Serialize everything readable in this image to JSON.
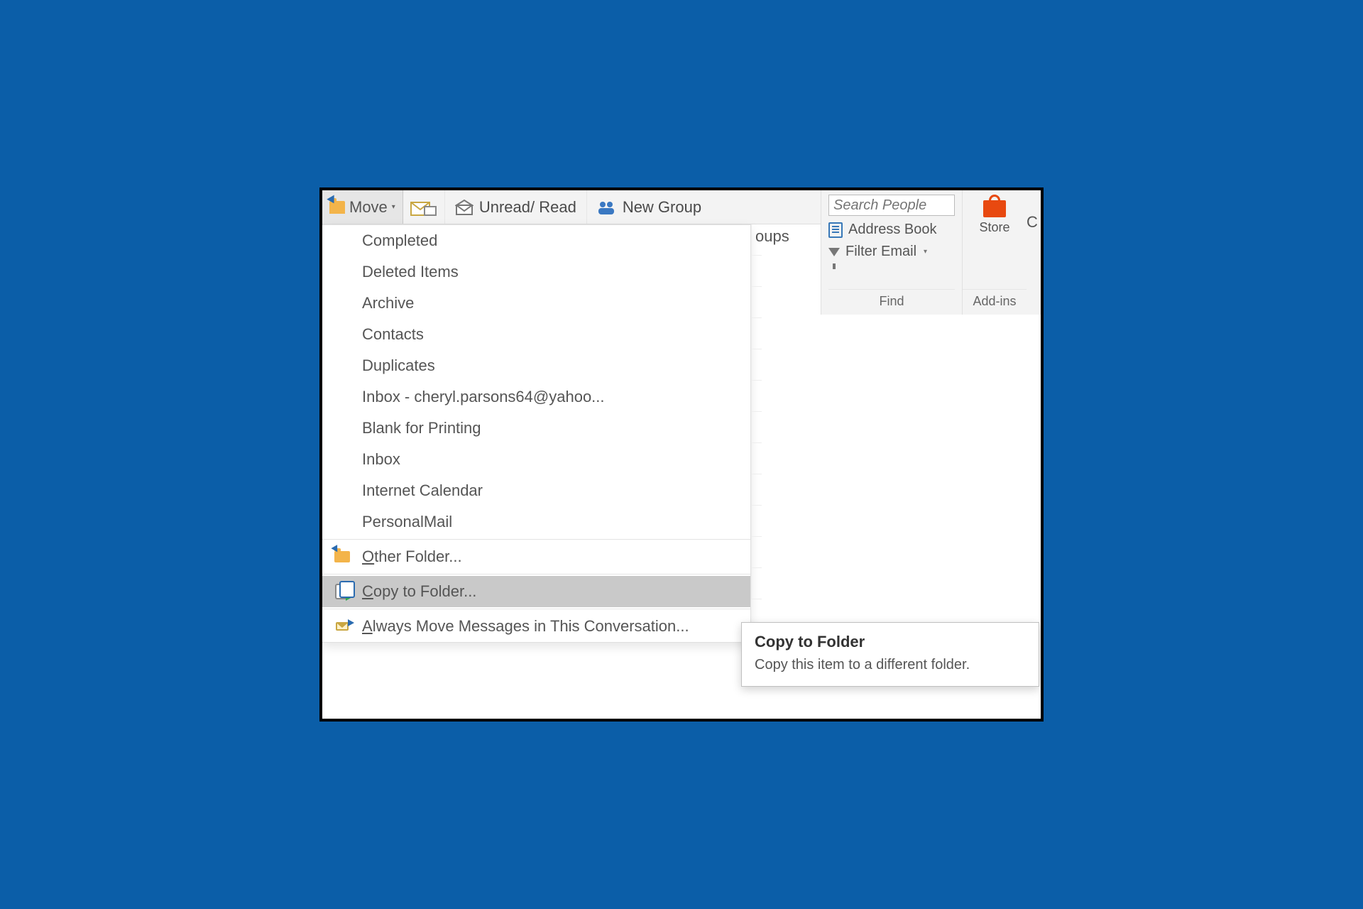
{
  "ribbon": {
    "move_label": "Move",
    "unread_read_label": "Unread/ Read",
    "new_group_label": "New Group",
    "partial_groups_snippet": "oups",
    "extra_right_char": "C"
  },
  "find": {
    "search_placeholder": "Search People",
    "address_book_label": "Address Book",
    "filter_email_label": "Filter Email",
    "group_label": "Find"
  },
  "addins": {
    "store_label": "Store",
    "group_label": "Add-ins"
  },
  "menu": {
    "folders": [
      "Completed",
      "Deleted Items",
      "Archive",
      "Contacts",
      "Duplicates",
      "Inbox - cheryl.parsons64@yahoo...",
      "Blank for Printing",
      "Inbox",
      "Internet Calendar",
      "PersonalMail"
    ],
    "other_folder_label": "Other Folder...",
    "copy_to_folder_label": "Copy to Folder...",
    "always_move_label": "Always Move Messages in This Conversation..."
  },
  "tooltip": {
    "title": "Copy to Folder",
    "body": "Copy this item to a different folder."
  }
}
